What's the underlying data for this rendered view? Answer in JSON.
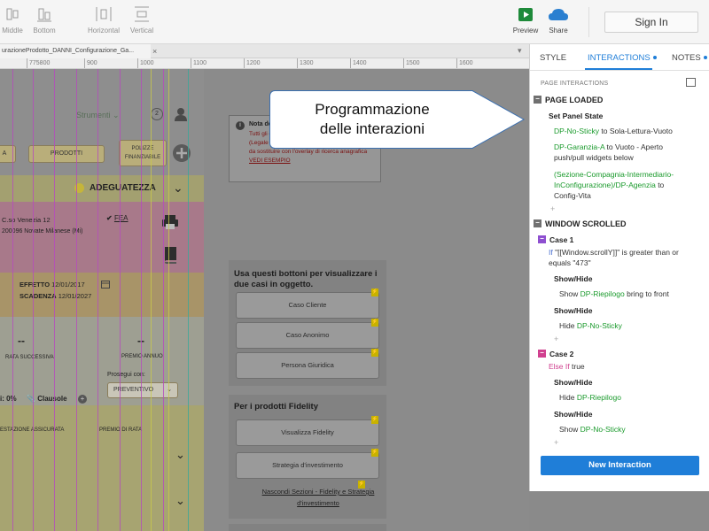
{
  "toolbar": {
    "left_items": [
      {
        "label": "Middle",
        "icon": "align-middle-icon"
      },
      {
        "label": "Bottom",
        "icon": "align-bottom-icon"
      },
      {
        "label": "Horizontal",
        "icon": "distribute-horizontal-icon"
      },
      {
        "label": "Vertical",
        "icon": "distribute-vertical-icon"
      }
    ],
    "preview_label": "Preview",
    "share_label": "Share",
    "signin_label": "Sign In"
  },
  "doc_tab": {
    "title": "urazioneProdotto_DANNI_Configurazione_Ga...",
    "close": "×"
  },
  "ruler": {
    "ticks": [
      "775800",
      "900",
      "1000",
      "1100",
      "1200",
      "1300",
      "1400",
      "1500",
      "1600"
    ]
  },
  "page": {
    "strumenti": "Strumenti",
    "step": "2",
    "btn_a": "A",
    "btn_prodotti": "PRODOTTI",
    "btn_side": "POLIZZE FINANZIABILE",
    "adeguatezza": "ADEGUATEZZA",
    "address_line1": "C.so Venezia 12",
    "address_line2": "200096 Novate Milanese (Mi)",
    "fea": "FEA",
    "effetto_label": "EFFETTO",
    "effetto_value": "12/01/2017",
    "scadenza_label": "SCADENZA",
    "scadenza_value": "12/01/2027",
    "dash": "--",
    "rata_successiva": "RATA SUCCESSIVA",
    "premio_annuo": "PREMIO ANNUO",
    "prosegui_con": "Prosegui con:",
    "preventivo": "PREVENTIVO",
    "pct": "i: 0%",
    "clausole": "Clausole",
    "prestazione": "ESTAZIONE ASSICURATA",
    "premio_rata": "PREMIO DI RATA"
  },
  "note_demo": {
    "title": "Nota demo",
    "text": "Tutti gli overlay per aggiunta di soggetti anagrafici (Legale rappresentate, assicurato, ecc...) saranno da sostituire con l'overlay di ricerca anagrafica",
    "link": "VEDI ESEMPIO"
  },
  "card1": {
    "title": "Usa questi bottoni per visualizzare i due casi in oggetto.",
    "buttons": [
      "Caso Cliente",
      "Caso Anonimo",
      "Persona Giuridica"
    ]
  },
  "card2": {
    "title": "Per i prodotti Fidelity",
    "buttons": [
      "Visualizza Fidelity",
      "Strategia d'investimento"
    ],
    "link": "Nascondi Sezioni - Fidelity e Strategia d'investimento"
  },
  "callout": {
    "text_line1": "Programmazione",
    "text_line2": "delle interazioni"
  },
  "right_panel": {
    "tabs": [
      "STYLE",
      "INTERACTIONS",
      "NOTES"
    ],
    "subtitle": "PAGE INTERACTIONS",
    "page_loaded": "PAGE LOADED",
    "set_panel_state": "Set Panel State",
    "pl_1_target": "DP-No-Sticky",
    "pl_1_rest": "to Sola-Lettura-Vuoto",
    "pl_2_target": "DP-Garanzia-A",
    "pl_2_rest": "to Vuoto - Aperto",
    "pl_2_rest2": "push/pull widgets below",
    "pl_3_target_a": "(Sezione-Compagnia-Intermediario-",
    "pl_3_target_b": "InConfigurazione)/DP-Agenzia",
    "pl_3_rest": "to",
    "pl_3_rest2": "Config-Vita",
    "window_scrolled": "WINDOW SCROLLED",
    "case1": "Case 1",
    "case1_if": "If",
    "case1_cond_a": "\"[[Window.scrollY]]\" is greater than or",
    "case1_cond_b": "equals \"473\"",
    "showhide": "Show/Hide",
    "c1_show_verb": "Show",
    "c1_show_target": "DP-Riepilogo",
    "c1_show_rest": "bring to front",
    "c1_hide_verb": "Hide",
    "c1_hide_target": "DP-No-Sticky",
    "case2": "Case 2",
    "case2_elseif": "Else If",
    "case2_cond": "true",
    "c2_hide_verb": "Hide",
    "c2_hide_target": "DP-Riepilogo",
    "c2_show_verb": "Show",
    "c2_show_target": "DP-No-Sticky",
    "plus": "+",
    "new_interaction": "New Interaction"
  },
  "colors": {
    "accent": "#1f7ed8",
    "target_green": "#1a9a2c",
    "case1_purple": "#8e4fd0",
    "case2_pink": "#d0408f"
  }
}
